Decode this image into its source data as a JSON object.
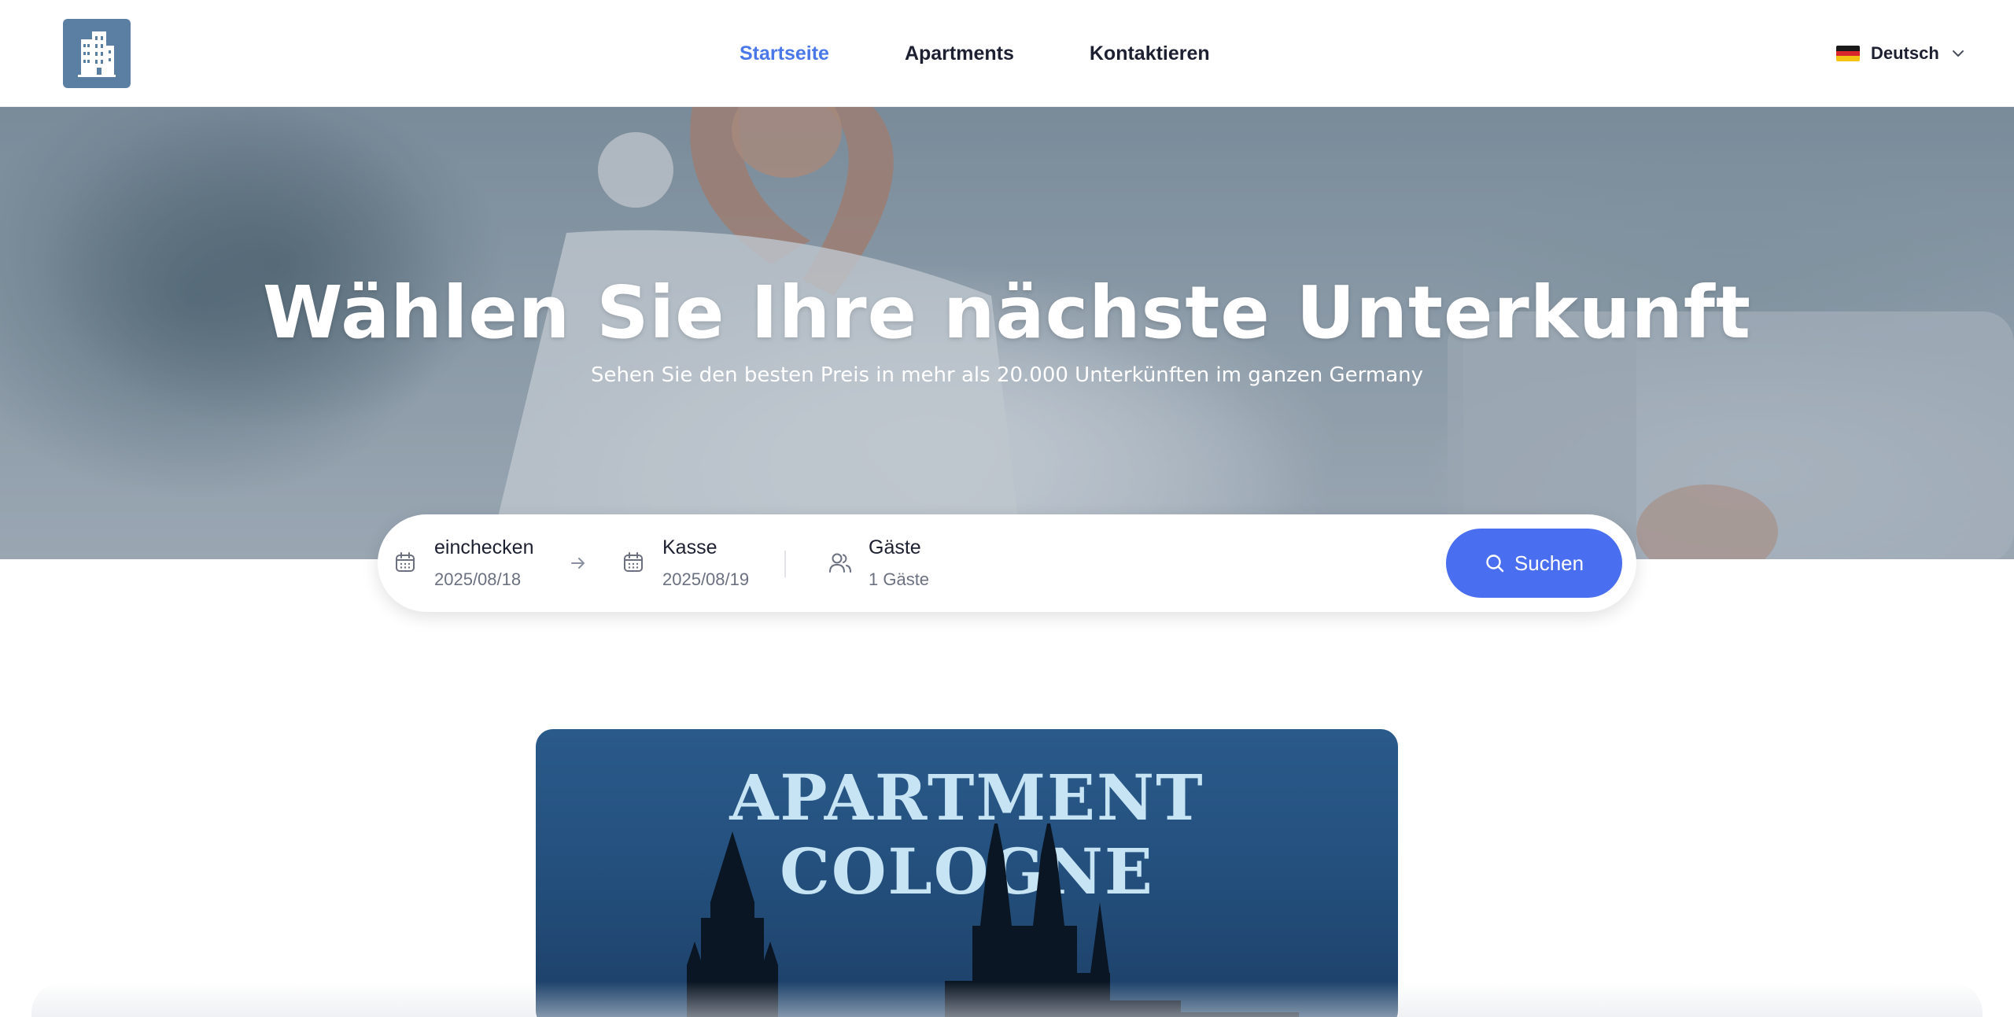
{
  "header": {
    "logo_icon": "building-icon",
    "nav": [
      {
        "label": "Startseite",
        "active": true
      },
      {
        "label": "Apartments",
        "active": false
      },
      {
        "label": "Kontaktieren",
        "active": false
      }
    ],
    "language": {
      "label": "Deutsch",
      "flag_icon": "germany-flag-icon",
      "chevron_icon": "chevron-down-icon"
    },
    "accent_color": "#4a78e8"
  },
  "hero": {
    "title": "Wählen Sie Ihre nächste Unterkunft",
    "subtitle": "Sehen Sie den besten Preis in mehr als 20.000 Unterkünften im ganzen Germany"
  },
  "search": {
    "checkin": {
      "label": "einchecken",
      "value": "2025/08/18",
      "icon": "calendar-icon"
    },
    "checkout": {
      "label": "Kasse",
      "value": "2025/08/19",
      "icon": "calendar-icon"
    },
    "arrow_icon": "arrow-right-icon",
    "guests": {
      "label": "Gäste",
      "value": "1 Gäste",
      "icon": "users-icon"
    },
    "button": {
      "label": "Suchen",
      "icon": "search-icon",
      "color": "#4a6ef0"
    }
  },
  "promo": {
    "title": "APARTMENT COLOGNE",
    "image": "cologne-cathedral-skyline"
  }
}
